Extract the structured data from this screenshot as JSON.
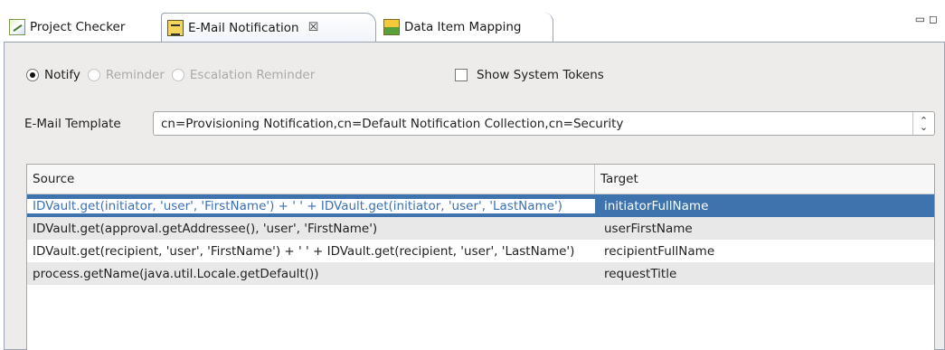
{
  "tabs": [
    {
      "label": "Project Checker",
      "icon": "project-checker-icon"
    },
    {
      "label": "E-Mail Notification",
      "icon": "email-notification-icon",
      "active": true,
      "close": "☒"
    },
    {
      "label": "Data Item Mapping",
      "icon": "data-item-mapping-icon"
    }
  ],
  "window_controls": {
    "minimize": "▭",
    "maximize": "◻"
  },
  "radios": [
    {
      "label": "Notify",
      "checked": true,
      "enabled": true
    },
    {
      "label": "Reminder",
      "checked": false,
      "enabled": false
    },
    {
      "label": "Escalation Reminder",
      "checked": false,
      "enabled": false
    }
  ],
  "show_system_tokens": {
    "label": "Show System Tokens",
    "checked": false
  },
  "template": {
    "label": "E-Mail Template",
    "value": "cn=Provisioning Notification,cn=Default Notification Collection,cn=Security"
  },
  "table": {
    "columns": [
      "Source",
      "Target"
    ],
    "rows": [
      {
        "source": "IDVault.get(initiator, 'user', 'FirstName') + ' ' + IDVault.get(initiator, 'user', 'LastName')",
        "target": "initiatorFullName",
        "selected": true
      },
      {
        "source": "IDVault.get(approval.getAddressee(), 'user', 'FirstName')",
        "target": "userFirstName"
      },
      {
        "source": "IDVault.get(recipient, 'user', 'FirstName') + ' ' + IDVault.get(recipient, 'user', 'LastName')",
        "target": "recipientFullName"
      },
      {
        "source": "process.getName(java.util.Locale.getDefault())",
        "target": "requestTitle"
      }
    ]
  },
  "colors": {
    "selection": "#3f73ad",
    "panel": "#edeceb",
    "alt_row": "#e8e8e8"
  }
}
